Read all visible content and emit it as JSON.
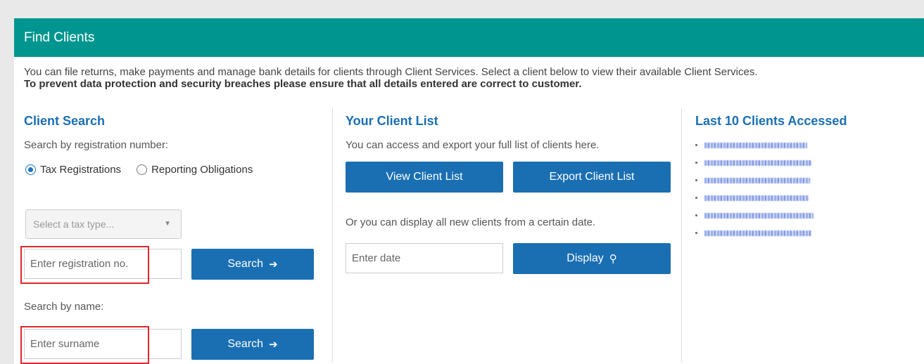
{
  "header": {
    "title": "Find Clients"
  },
  "intro": {
    "line1": "You can file returns, make payments and manage bank details for clients through Client Services. Select a client below to view their available Client Services.",
    "line2": "To prevent data protection and security breaches please ensure that all details entered are correct to customer."
  },
  "client_search": {
    "title": "Client Search",
    "by_reg_label": "Search by registration number:",
    "radio_tax": "Tax Registrations",
    "radio_reporting": "Reporting Obligations",
    "tax_type_placeholder": "Select a tax type...",
    "reg_placeholder": "Enter registration no.",
    "search_label": "Search",
    "by_name_label": "Search by name:",
    "surname_placeholder": "Enter surname"
  },
  "client_list": {
    "title": "Your Client List",
    "desc": "You can access and export your full list of clients here.",
    "view_label": "View Client List",
    "export_label": "Export Client List",
    "date_desc": "Or you can display all new clients from a certain date.",
    "date_placeholder": "Enter date",
    "display_label": "Display"
  },
  "recent": {
    "title": "Last 10 Clients Accessed",
    "item_count_shown": 6
  },
  "colors": {
    "header": "#00968f",
    "accent": "#1a6fb3",
    "highlight": "#e0262e"
  }
}
